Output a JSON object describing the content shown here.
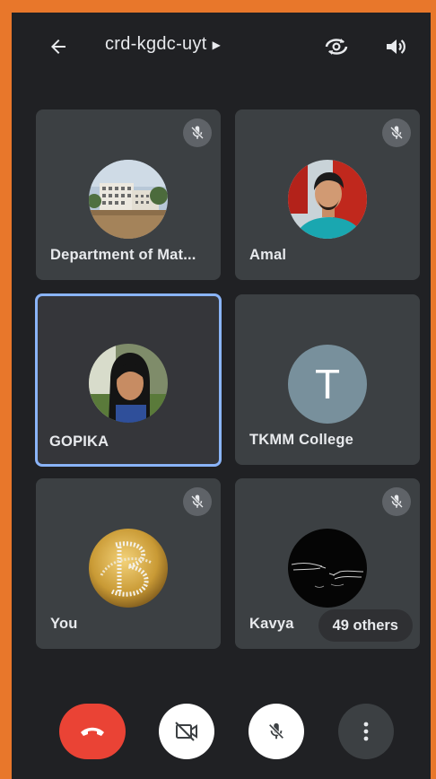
{
  "header": {
    "title": "crd-kgdc-uyt",
    "back_icon": "back-arrow-icon",
    "switch_camera_icon": "switch-camera-icon",
    "speaker_icon": "speaker-icon"
  },
  "tiles": [
    {
      "name": "Department of Mat...",
      "muted": true,
      "avatar": "building-photo"
    },
    {
      "name": "Amal",
      "muted": true,
      "avatar": "person-photo"
    },
    {
      "name": "GOPIKA",
      "muted": false,
      "active": true,
      "avatar": "person-photo"
    },
    {
      "name": "TKMM College",
      "muted": false,
      "avatar_letter": "T"
    },
    {
      "name": "You",
      "muted": true,
      "avatar": "golden-logo"
    },
    {
      "name": "Kavya",
      "muted": true,
      "avatar": "sketch-hands"
    }
  ],
  "others_chip": "49 others",
  "controls": {
    "end_call": "end-call-icon",
    "camera": "camera-off-icon",
    "microphone": "mic-off-icon",
    "more": "more-vert-icon"
  },
  "colors": {
    "background": "#202124",
    "tile": "#3c4043",
    "active_border": "#8ab4f8",
    "end_call": "#ea4335",
    "frame": "#e8772b"
  }
}
